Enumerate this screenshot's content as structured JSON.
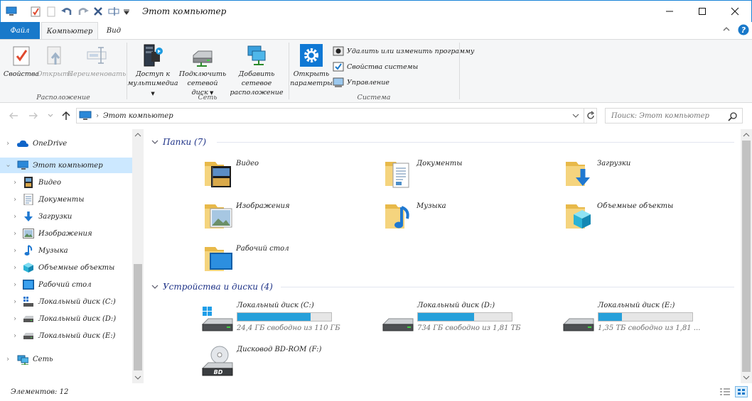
{
  "window": {
    "title": "Этот компьютер"
  },
  "tabs": {
    "file": "Файл",
    "computer": "Компьютер",
    "view": "Вид"
  },
  "ribbon": {
    "location": {
      "label": "Расположение",
      "properties": "Свойства",
      "open": "Открыть",
      "rename": "Переименовать"
    },
    "network": {
      "label": "Сеть",
      "media_line1": "Доступ к",
      "media_line2": "мультимедиа",
      "map_line1": "Подключить",
      "map_line2": "сетевой диск",
      "add_line1": "Добавить сетевое",
      "add_line2": "расположение"
    },
    "system": {
      "label": "Система",
      "settings_line1": "Открыть",
      "settings_line2": "параметры",
      "uninstall": "Удалить или изменить программу",
      "sys_props": "Свойства системы",
      "manage": "Управление"
    }
  },
  "address": {
    "path": "Этот компьютер",
    "search_placeholder": "Поиск: Этот компьютер"
  },
  "sidebar": {
    "onedrive": "OneDrive",
    "this_pc": "Этот компьютер",
    "items": [
      "Видео",
      "Документы",
      "Загрузки",
      "Изображения",
      "Музыка",
      "Объемные объекты",
      "Рабочий стол",
      "Локальный диск (C:)",
      "Локальный диск (D:)",
      "Локальный диск (E:)"
    ],
    "network": "Сеть"
  },
  "folders": {
    "header": "Папки (7)",
    "items": [
      "Видео",
      "Документы",
      "Загрузки",
      "Изображения",
      "Музыка",
      "Объемные объекты",
      "Рабочий стол"
    ]
  },
  "devices": {
    "header": "Устройства и диски (4)",
    "drives": [
      {
        "name": "Локальный диск (C:)",
        "free": "24,4 ГБ свободно из 110 ГБ",
        "used_fraction": 0.78
      },
      {
        "name": "Локальный диск (D:)",
        "free": "734 ГБ свободно из 1,81 ТБ",
        "used_fraction": 0.6
      },
      {
        "name": "Локальный диск (E:)",
        "free": "1,35 ТБ свободно из 1,81 ...",
        "used_fraction": 0.25
      }
    ],
    "dvd": "Дисковод BD-ROM (F:)"
  },
  "status": {
    "count": "Элементов: 12"
  }
}
